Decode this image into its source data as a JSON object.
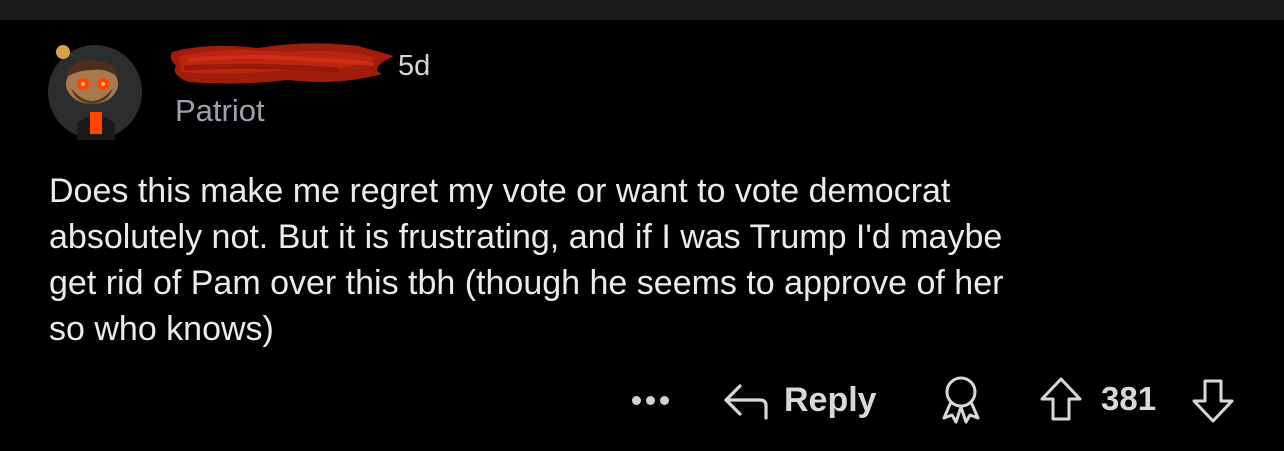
{
  "comment": {
    "timestamp": "5d",
    "flair": "Patriot",
    "body": "Does this make me regret my vote or want to vote democrat\nabsolutely not. But it is frustrating, and if I was Trump I'd maybe\nget rid of Pam over this tbh (though he seems to approve of her\nso who knows)"
  },
  "actions": {
    "reply_label": "Reply",
    "score": "381"
  },
  "icons": {
    "avatar": "snoo-avatar",
    "more": "more-icon",
    "reply": "reply-arrow-icon",
    "award": "award-icon",
    "upvote": "upvote-arrow-icon",
    "downvote": "downvote-arrow-icon"
  },
  "colors": {
    "background": "#000000",
    "text": "#e9ebed",
    "muted": "#9aa3ad",
    "redaction": "#b3220f"
  }
}
